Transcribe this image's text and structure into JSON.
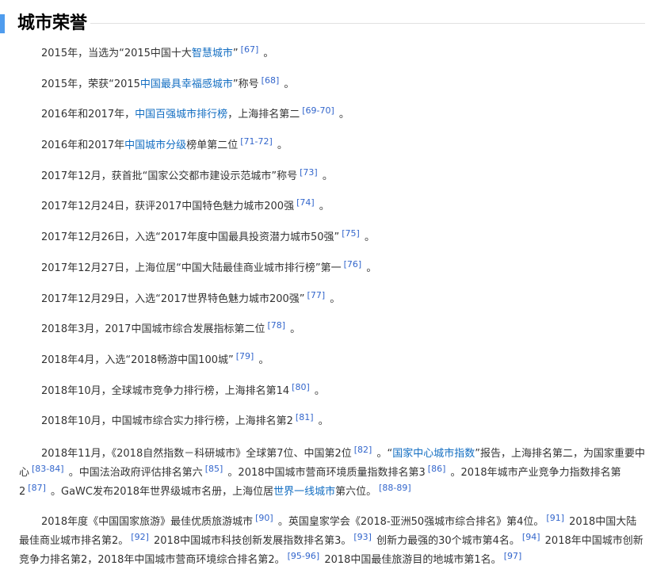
{
  "section": {
    "title": "城市荣誉"
  },
  "paragraphs": [
    [
      {
        "t": "text",
        "v": "2015年，当选为“2015中国十大"
      },
      {
        "t": "link",
        "v": "智慧城市"
      },
      {
        "t": "text",
        "v": "”"
      },
      {
        "t": "ref",
        "v": "[67]"
      },
      {
        "t": "text",
        "v": " 。"
      }
    ],
    [
      {
        "t": "text",
        "v": "2015年，荣获“2015"
      },
      {
        "t": "link",
        "v": "中国最具幸福感城市"
      },
      {
        "t": "text",
        "v": "”称号"
      },
      {
        "t": "ref",
        "v": "[68]"
      },
      {
        "t": "text",
        "v": " 。"
      }
    ],
    [
      {
        "t": "text",
        "v": "2016年和2017年，"
      },
      {
        "t": "link",
        "v": "中国百强城市排行榜"
      },
      {
        "t": "text",
        "v": "，上海排名第二"
      },
      {
        "t": "ref",
        "v": "[69-70]"
      },
      {
        "t": "text",
        "v": " 。"
      }
    ],
    [
      {
        "t": "text",
        "v": "2016年和2017年"
      },
      {
        "t": "link",
        "v": "中国城市分级"
      },
      {
        "t": "text",
        "v": "榜单第二位"
      },
      {
        "t": "ref",
        "v": "[71-72]"
      },
      {
        "t": "text",
        "v": " 。"
      }
    ],
    [
      {
        "t": "text",
        "v": "2017年12月，获首批“国家公交都市建设示范城市”称号"
      },
      {
        "t": "ref",
        "v": "[73]"
      },
      {
        "t": "text",
        "v": " 。"
      }
    ],
    [
      {
        "t": "text",
        "v": "2017年12月24日，获评2017中国特色魅力城市200强"
      },
      {
        "t": "ref",
        "v": "[74]"
      },
      {
        "t": "text",
        "v": " 。"
      }
    ],
    [
      {
        "t": "text",
        "v": "2017年12月26日，入选“2017年度中国最具投资潜力城市50强”"
      },
      {
        "t": "ref",
        "v": "[75]"
      },
      {
        "t": "text",
        "v": " 。"
      }
    ],
    [
      {
        "t": "text",
        "v": "2017年12月27日，上海位居“中国大陆最佳商业城市排行榜”第一"
      },
      {
        "t": "ref",
        "v": "[76]"
      },
      {
        "t": "text",
        "v": " 。"
      }
    ],
    [
      {
        "t": "text",
        "v": "2017年12月29日，入选“2017世界特色魅力城市200强”"
      },
      {
        "t": "ref",
        "v": "[77]"
      },
      {
        "t": "text",
        "v": " 。"
      }
    ],
    [
      {
        "t": "text",
        "v": "2018年3月，2017中国城市综合发展指标第二位"
      },
      {
        "t": "ref",
        "v": "[78]"
      },
      {
        "t": "text",
        "v": " 。"
      }
    ],
    [
      {
        "t": "text",
        "v": "2018年4月，入选“2018畅游中国100城”"
      },
      {
        "t": "ref",
        "v": "[79]"
      },
      {
        "t": "text",
        "v": " 。"
      }
    ],
    [
      {
        "t": "text",
        "v": "2018年10月，全球城市竞争力排行榜，上海排名第14"
      },
      {
        "t": "ref",
        "v": "[80]"
      },
      {
        "t": "text",
        "v": " 。"
      }
    ],
    [
      {
        "t": "text",
        "v": "2018年10月，中国城市综合实力排行榜，上海排名第2"
      },
      {
        "t": "ref",
        "v": "[81]"
      },
      {
        "t": "text",
        "v": " 。"
      }
    ],
    [
      {
        "t": "text",
        "v": "2018年11月，《2018自然指数－科研城市》全球第7位、中国第2位"
      },
      {
        "t": "ref",
        "v": "[82]"
      },
      {
        "t": "text",
        "v": " 。“"
      },
      {
        "t": "link",
        "v": "国家中心城市指数"
      },
      {
        "t": "text",
        "v": "”报告，上海排名第二，为国家重要中心"
      },
      {
        "t": "ref",
        "v": "[83-84]"
      },
      {
        "t": "text",
        "v": " 。中国法治政府评估排名第六"
      },
      {
        "t": "ref",
        "v": "[85]"
      },
      {
        "t": "text",
        "v": " 。2018中国城市营商环境质量指数排名第3"
      },
      {
        "t": "ref",
        "v": "[86]"
      },
      {
        "t": "text",
        "v": " 。2018年城市产业竞争力指数排名第2"
      },
      {
        "t": "ref",
        "v": "[87]"
      },
      {
        "t": "text",
        "v": " 。GaWC发布2018年世界级城市名册，上海位居"
      },
      {
        "t": "link",
        "v": "世界一线城市"
      },
      {
        "t": "text",
        "v": "第六位。"
      },
      {
        "t": "ref",
        "v": "[88-89]"
      }
    ],
    [
      {
        "t": "text",
        "v": "2018年度《中国国家旅游》最佳优质旅游城市"
      },
      {
        "t": "ref",
        "v": "[90]"
      },
      {
        "t": "text",
        "v": " 。英国皇家学会《2018-亚洲50强城市综合排名》第4位。"
      },
      {
        "t": "ref",
        "v": "[91]"
      },
      {
        "t": "text",
        "v": " 2018中国大陆最佳商业城市排名第2。"
      },
      {
        "t": "ref",
        "v": "[92]"
      },
      {
        "t": "text",
        "v": " 2018中国城市科技创新发展指数排名第3。"
      },
      {
        "t": "ref",
        "v": "[93]"
      },
      {
        "t": "text",
        "v": " 创新力最强的30个城市第4名。"
      },
      {
        "t": "ref",
        "v": "[94]"
      },
      {
        "t": "text",
        "v": " 2018年中国城市创新竞争力排名第2，2018年中国城市营商环境综合排名第2。"
      },
      {
        "t": "ref",
        "v": "[95-96]"
      },
      {
        "t": "text",
        "v": " 2018中国最佳旅游目的地城市第1名。"
      },
      {
        "t": "ref",
        "v": "[97]"
      }
    ]
  ],
  "colors": {
    "accent_bar": "#4f9cee",
    "link": "#136ec2",
    "ref": "#3366cc",
    "text": "#333333"
  }
}
